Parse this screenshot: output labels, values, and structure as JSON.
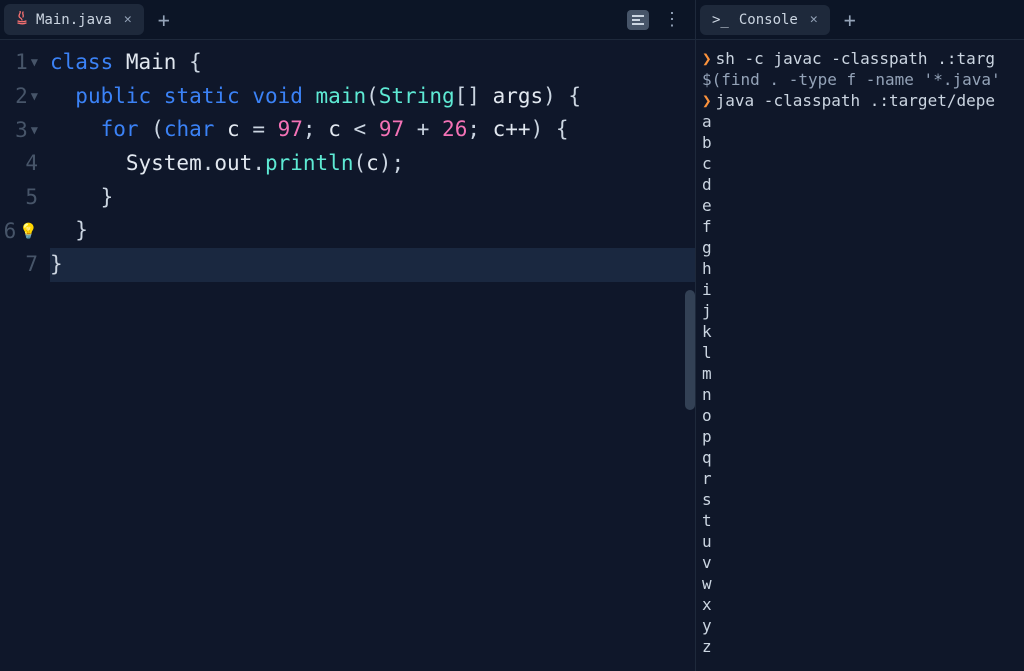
{
  "editor": {
    "tab": {
      "filename": "Main.java"
    },
    "lines": [
      {
        "num": "1",
        "fold": true
      },
      {
        "num": "2",
        "fold": true
      },
      {
        "num": "3",
        "fold": true
      },
      {
        "num": "4",
        "fold": false
      },
      {
        "num": "5",
        "fold": false
      },
      {
        "num": "6",
        "fold": false,
        "bulb": true
      },
      {
        "num": "7",
        "fold": false
      }
    ],
    "code": {
      "l1": {
        "kw": "class",
        "cls": " Main ",
        "br": "{"
      },
      "l2": {
        "indent": "  ",
        "kw1": "public",
        "kw2": " static",
        "kw3": " void",
        "fn": " main",
        "p1": "(",
        "type": "String",
        "p2": "[] ",
        "arg": "args",
        "p3": ") {"
      },
      "l3": {
        "indent": "    ",
        "kw": "for",
        "p1": " (",
        "type": "char",
        "var": " c ",
        "eq": "= ",
        "n1": "97",
        "sc1": "; ",
        "v2": "c ",
        "lt": "< ",
        "n2": "97",
        "pl": " + ",
        "n3": "26",
        "sc2": "; ",
        "inc": "c++",
        "p2": ") {"
      },
      "l4": {
        "indent": "      ",
        "sys": "System",
        "d1": ".",
        "out": "out",
        "d2": ".",
        "fn": "println",
        "p1": "(",
        "arg": "c",
        "p2": ");"
      },
      "l5": {
        "indent": "    ",
        "br": "}"
      },
      "l6": {
        "indent": "  ",
        "br": "}"
      },
      "l7": {
        "br": "}"
      }
    }
  },
  "console": {
    "tab": {
      "title": "Console"
    },
    "lines": [
      {
        "prompt": true,
        "text": "sh -c javac -classpath .:targ"
      },
      {
        "prompt": false,
        "text": "$(find . -type f -name '*.java'"
      },
      {
        "prompt": true,
        "text": "java -classpath .:target/depe"
      }
    ],
    "output": [
      "a",
      "b",
      "c",
      "d",
      "e",
      "f",
      "g",
      "h",
      "i",
      "j",
      "k",
      "l",
      "m",
      "n",
      "o",
      "p",
      "q",
      "r",
      "s",
      "t",
      "u",
      "v",
      "w",
      "x",
      "y",
      "z"
    ]
  }
}
